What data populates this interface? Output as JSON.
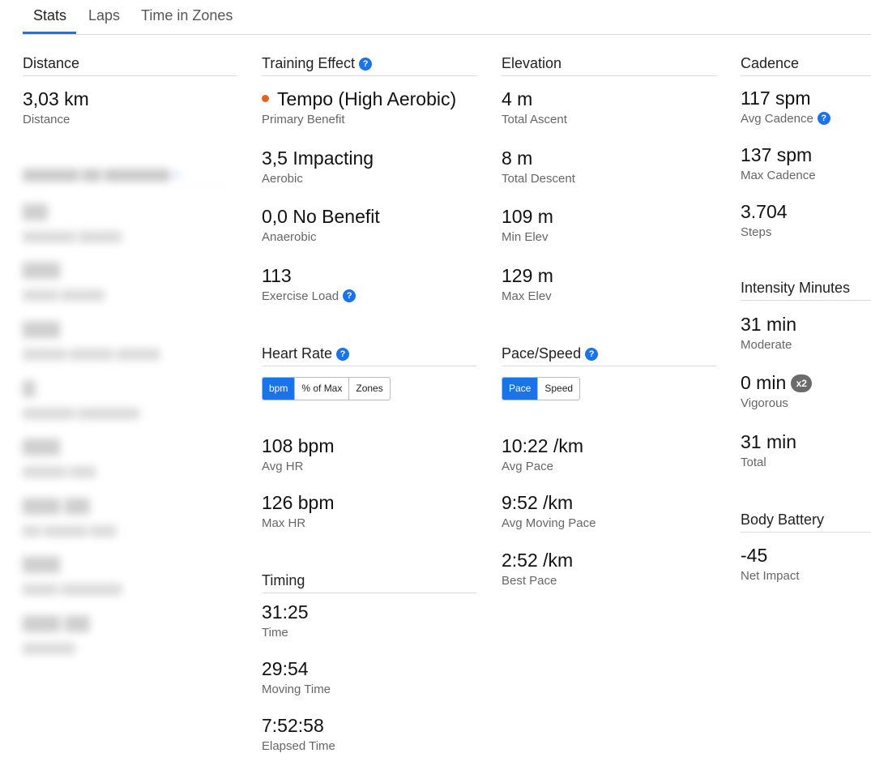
{
  "tabs": [
    {
      "label": "Stats",
      "active": true
    },
    {
      "label": "Laps",
      "active": false
    },
    {
      "label": "Time in Zones",
      "active": false
    }
  ],
  "colors": {
    "accent": "#1a73e8",
    "tempo_dot": "#e8601c"
  },
  "distance": {
    "title": "Distance",
    "value": "3,03 km",
    "label": "Distance"
  },
  "training_effect": {
    "title": "Training Effect",
    "primary": {
      "value": "Tempo (High Aerobic)",
      "label": "Primary Benefit"
    },
    "aerobic": {
      "value": "3,5 Impacting",
      "label": "Aerobic"
    },
    "anaerobic": {
      "value": "0,0 No Benefit",
      "label": "Anaerobic"
    },
    "load": {
      "value": "113",
      "label": "Exercise Load"
    }
  },
  "elevation": {
    "title": "Elevation",
    "items": [
      {
        "value": "4 m",
        "label": "Total Ascent"
      },
      {
        "value": "8 m",
        "label": "Total Descent"
      },
      {
        "value": "109 m",
        "label": "Min Elev"
      },
      {
        "value": "129 m",
        "label": "Max Elev"
      }
    ]
  },
  "cadence": {
    "title": "Cadence",
    "avg": {
      "value": "117 spm",
      "label": "Avg Cadence"
    },
    "max": {
      "value": "137 spm",
      "label": "Max Cadence"
    },
    "steps": {
      "value": "3.704",
      "label": "Steps"
    }
  },
  "intensity": {
    "title": "Intensity Minutes",
    "moderate": {
      "value": "31 min",
      "label": "Moderate"
    },
    "vigorous": {
      "value": "0 min",
      "label": "Vigorous",
      "badge": "x2"
    },
    "total": {
      "value": "31 min",
      "label": "Total"
    }
  },
  "body_battery": {
    "title": "Body Battery",
    "value": "-45",
    "label": "Net Impact"
  },
  "heart_rate": {
    "title": "Heart Rate",
    "toggle": [
      "bpm",
      "% of Max",
      "Zones"
    ],
    "avg": {
      "value": "108 bpm",
      "label": "Avg HR"
    },
    "max": {
      "value": "126 bpm",
      "label": "Max HR"
    }
  },
  "pace": {
    "title": "Pace/Speed",
    "toggle": [
      "Pace",
      "Speed"
    ],
    "avg": {
      "value": "10:22 /km",
      "label": "Avg Pace"
    },
    "moving": {
      "value": "9:52 /km",
      "label": "Avg Moving Pace"
    },
    "best": {
      "value": "2:52 /km",
      "label": "Best Pace"
    }
  },
  "timing": {
    "title": "Timing",
    "time": {
      "value": "31:25",
      "label": "Time"
    },
    "moving": {
      "value": "29:54",
      "label": "Moving Time"
    },
    "elapsed": {
      "value": "7:52:58",
      "label": "Elapsed Time"
    }
  }
}
